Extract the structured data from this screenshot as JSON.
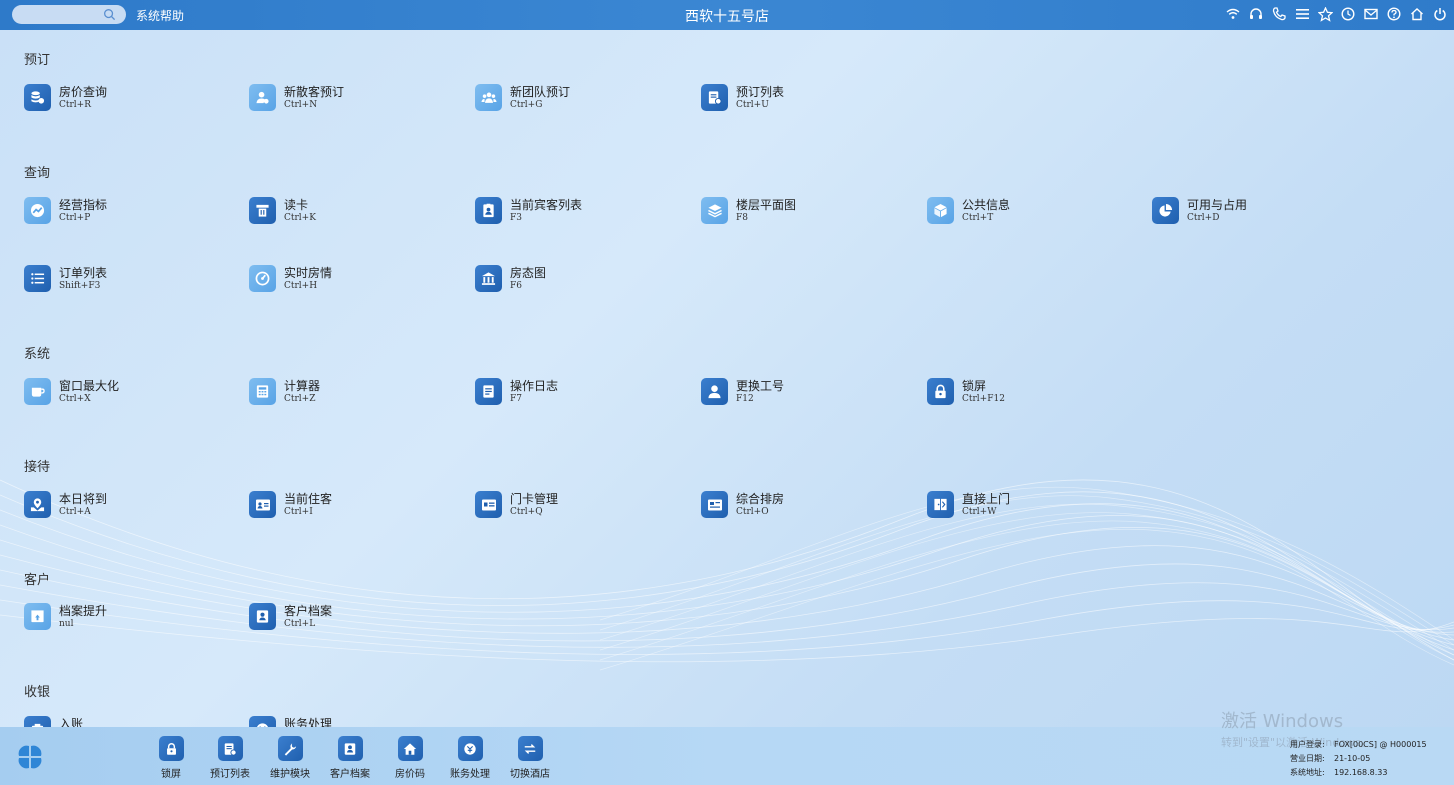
{
  "topbar": {
    "help": "系统帮助",
    "title": "西软十五号店",
    "icons": [
      "wifi-icon",
      "headset-icon",
      "phone-icon",
      "menu-icon",
      "star-icon",
      "clock-icon",
      "mail-icon",
      "help-icon",
      "home-icon",
      "power-icon"
    ]
  },
  "sections": [
    {
      "title": "预订",
      "items": [
        {
          "label": "房价查询",
          "shortcut": "Ctrl+R",
          "icon": "rate-query-icon",
          "tone": "dark"
        },
        {
          "label": "新散客预订",
          "shortcut": "Ctrl+N",
          "icon": "new-guest-icon",
          "tone": "light"
        },
        {
          "label": "新团队预订",
          "shortcut": "Ctrl+G",
          "icon": "group-icon",
          "tone": "light"
        },
        {
          "label": "预订列表",
          "shortcut": "Ctrl+U",
          "icon": "booking-list-icon",
          "tone": "dark"
        }
      ]
    },
    {
      "title": "查询",
      "items": [
        {
          "label": "经营指标",
          "shortcut": "Ctrl+P",
          "icon": "chart-icon",
          "tone": "light"
        },
        {
          "label": "读卡",
          "shortcut": "Ctrl+K",
          "icon": "card-reader-icon",
          "tone": "dark"
        },
        {
          "label": "当前宾客列表",
          "shortcut": "F3",
          "icon": "guest-list-icon",
          "tone": "dark"
        },
        {
          "label": "楼层平面图",
          "shortcut": "F8",
          "icon": "layers-icon",
          "tone": "light"
        },
        {
          "label": "公共信息",
          "shortcut": "Ctrl+T",
          "icon": "cube-icon",
          "tone": "light"
        },
        {
          "label": "可用与占用",
          "shortcut": "Ctrl+D",
          "icon": "pie-icon",
          "tone": "dark"
        },
        {
          "label": "订单列表",
          "shortcut": "Shift+F3",
          "icon": "list-icon",
          "tone": "dark"
        },
        {
          "label": "实时房情",
          "shortcut": "Ctrl+H",
          "icon": "gauge-icon",
          "tone": "light"
        },
        {
          "label": "房态图",
          "shortcut": "F6",
          "icon": "building-icon",
          "tone": "dark"
        }
      ]
    },
    {
      "title": "系统",
      "items": [
        {
          "label": "窗口最大化",
          "shortcut": "Ctrl+X",
          "icon": "cup-icon",
          "tone": "light"
        },
        {
          "label": "计算器",
          "shortcut": "Ctrl+Z",
          "icon": "calculator-icon",
          "tone": "light"
        },
        {
          "label": "操作日志",
          "shortcut": "F7",
          "icon": "document-icon",
          "tone": "dark"
        },
        {
          "label": "更换工号",
          "shortcut": "F12",
          "icon": "user-icon",
          "tone": "dark"
        },
        {
          "label": "锁屏",
          "shortcut": "Ctrl+F12",
          "icon": "lock-icon",
          "tone": "dark"
        }
      ]
    },
    {
      "title": "接待",
      "items": [
        {
          "label": "本日将到",
          "shortcut": "Ctrl+A",
          "icon": "arrival-icon",
          "tone": "dark"
        },
        {
          "label": "当前住客",
          "shortcut": "Ctrl+I",
          "icon": "id-card-icon",
          "tone": "dark"
        },
        {
          "label": "门卡管理",
          "shortcut": "Ctrl+Q",
          "icon": "door-card-icon",
          "tone": "dark"
        },
        {
          "label": "综合排房",
          "shortcut": "Ctrl+O",
          "icon": "room-assign-icon",
          "tone": "dark"
        },
        {
          "label": "直接上门",
          "shortcut": "Ctrl+W",
          "icon": "walk-in-icon",
          "tone": "dark"
        }
      ]
    },
    {
      "title": "客户",
      "items": [
        {
          "label": "档案提升",
          "shortcut": "nul",
          "icon": "profile-upgrade-icon",
          "tone": "light"
        },
        {
          "label": "客户档案",
          "shortcut": "Ctrl+L",
          "icon": "profile-icon",
          "tone": "dark"
        }
      ]
    },
    {
      "title": "收银",
      "items": [
        {
          "label": "入账",
          "shortcut": "",
          "icon": "post-icon",
          "tone": "dark"
        },
        {
          "label": "账务处理",
          "shortcut": "",
          "icon": "billing-icon",
          "tone": "dark"
        }
      ]
    }
  ],
  "dock": [
    {
      "label": "锁屏",
      "icon": "lock-icon"
    },
    {
      "label": "预订列表",
      "icon": "booking-list-icon"
    },
    {
      "label": "维护模块",
      "icon": "wrench-icon"
    },
    {
      "label": "客户档案",
      "icon": "profile-icon"
    },
    {
      "label": "房价码",
      "icon": "house-icon"
    },
    {
      "label": "账务处理",
      "icon": "billing-icon"
    },
    {
      "label": "切换酒店",
      "icon": "switch-icon"
    }
  ],
  "watermark": {
    "line1": "激活 Windows",
    "line2": "转到\"设置\"以激活 Windows。"
  },
  "status": {
    "user_label": "用户登录:",
    "user_value": "FOX[00CS] @ H000015",
    "date_label": "营业日期:",
    "date_value": "21-10-05",
    "addr_label": "系统地址:",
    "addr_value": "192.168.8.33"
  },
  "colors": {
    "topbar": "#2e7ac9",
    "icon_dark": "#1f5fae",
    "icon_light": "#58a3e6"
  }
}
